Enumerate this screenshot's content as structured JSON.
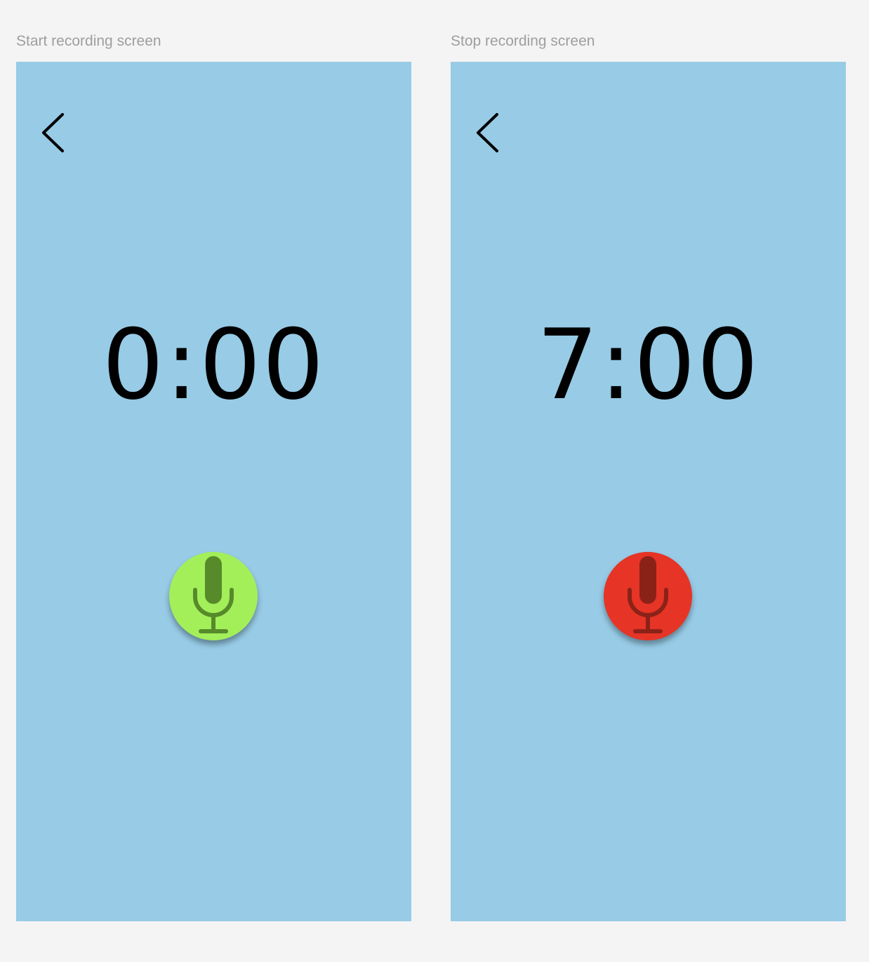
{
  "screens": [
    {
      "title": "Start recording screen",
      "timer": "0:00",
      "back_icon": "chevron-left-icon",
      "mic_icon": "microphone-icon",
      "button_color": "#a3ef5a",
      "icon_color": "#568a2a"
    },
    {
      "title": "Stop recording screen",
      "timer": "7:00",
      "back_icon": "chevron-left-icon",
      "mic_icon": "microphone-icon",
      "button_color": "#e63426",
      "icon_color": "#8b2218"
    }
  ]
}
